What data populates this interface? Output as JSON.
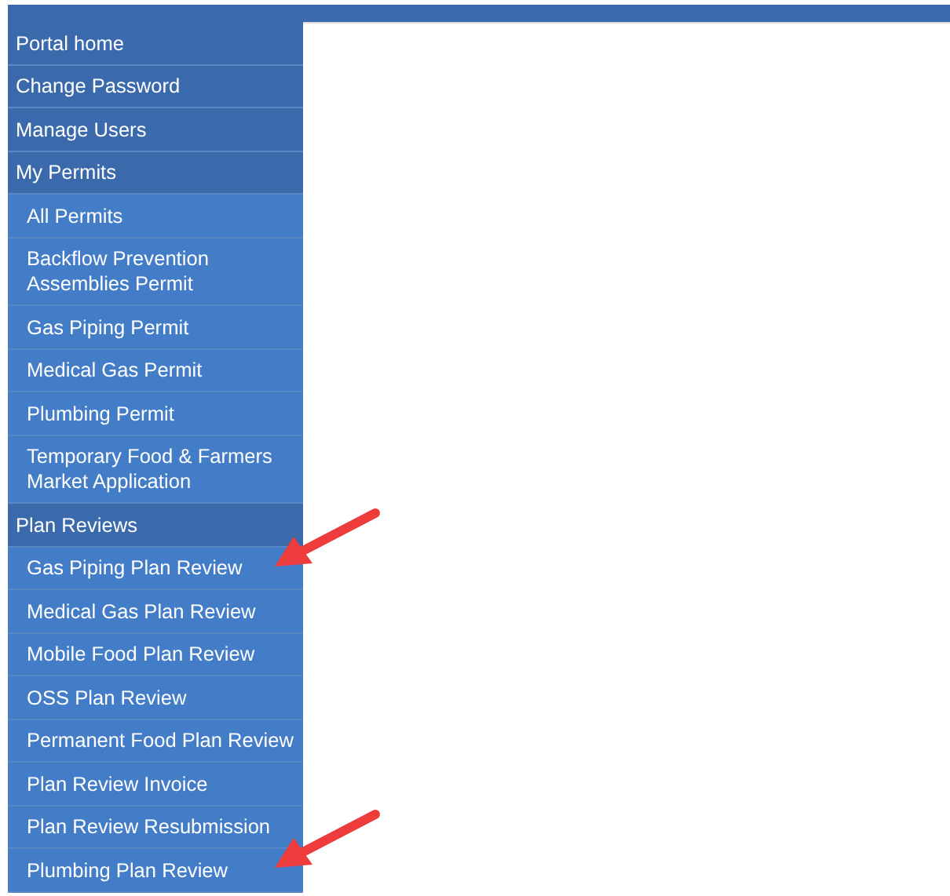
{
  "menu": [
    {
      "label": "Portal home"
    },
    {
      "label": "Change Password"
    },
    {
      "label": "Manage Users"
    },
    {
      "label": "My Permits",
      "children": [
        {
          "label": "All Permits",
          "pointed": false
        },
        {
          "label": "Backflow Prevention Assemblies Permit",
          "pointed": false
        },
        {
          "label": "Gas Piping Permit",
          "pointed": false
        },
        {
          "label": "Medical Gas Permit",
          "pointed": false
        },
        {
          "label": "Plumbing Permit",
          "pointed": false
        },
        {
          "label": "Temporary Food & Farmers Market Application",
          "pointed": false
        }
      ]
    },
    {
      "label": "Plan Reviews",
      "children": [
        {
          "label": "Gas Piping Plan Review",
          "pointed": true
        },
        {
          "label": "Medical Gas Plan Review",
          "pointed": false
        },
        {
          "label": "Mobile Food Plan Review",
          "pointed": false
        },
        {
          "label": "OSS Plan Review",
          "pointed": false
        },
        {
          "label": "Permanent Food Plan Review",
          "pointed": false
        },
        {
          "label": "Plan Review Invoice",
          "pointed": false
        },
        {
          "label": "Plan Review Resubmission",
          "pointed": false
        },
        {
          "label": "Plumbing Plan Review",
          "pointed": true
        }
      ]
    }
  ]
}
